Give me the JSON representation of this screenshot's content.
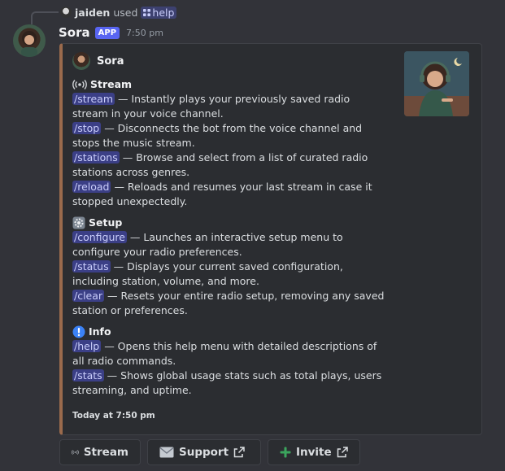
{
  "reply": {
    "user": "jaiden",
    "action": "used",
    "command": "help"
  },
  "message": {
    "author": "Sora",
    "badge": "APP",
    "time": "7:50 pm"
  },
  "embed": {
    "author": "Sora",
    "accent_color": "#9a6a4c",
    "sections": [
      {
        "icon": "radio-waves-icon",
        "title": "Stream",
        "items": [
          {
            "command": "/stream",
            "text": " — Instantly plays your previously saved radio stream in your voice channel."
          },
          {
            "command": "/stop",
            "text": " — Disconnects the bot from the voice channel and stops the music stream."
          },
          {
            "command": "/stations",
            "text": " — Browse and select from a list of curated radio stations across genres."
          },
          {
            "command": "/reload",
            "text": " — Reloads and resumes your last stream in case it stopped unexpectedly."
          }
        ]
      },
      {
        "icon": "gear-icon",
        "title": "Setup",
        "items": [
          {
            "command": "/configure",
            "text": " — Launches an interactive setup menu to configure your radio preferences."
          },
          {
            "command": "/status",
            "text": " — Displays your current saved configuration, including station, volume, and more."
          },
          {
            "command": "/clear",
            "text": " — Resets your entire radio setup, removing any saved station or preferences."
          }
        ]
      },
      {
        "icon": "exclamation-icon",
        "title": "Info",
        "items": [
          {
            "command": "/help",
            "text": " — Opens this help menu with detailed descriptions of all radio commands."
          },
          {
            "command": "/stats",
            "text": " — Shows global usage stats such as total plays, users streaming, and uptime."
          }
        ]
      }
    ],
    "footer": "Today at 7:50 pm"
  },
  "buttons": [
    {
      "label": "Stream",
      "icon": "radio-waves-icon",
      "external": false
    },
    {
      "label": "Support",
      "icon": "envelope-icon",
      "external": true
    },
    {
      "label": "Invite",
      "icon": "plus-icon",
      "external": true
    }
  ]
}
